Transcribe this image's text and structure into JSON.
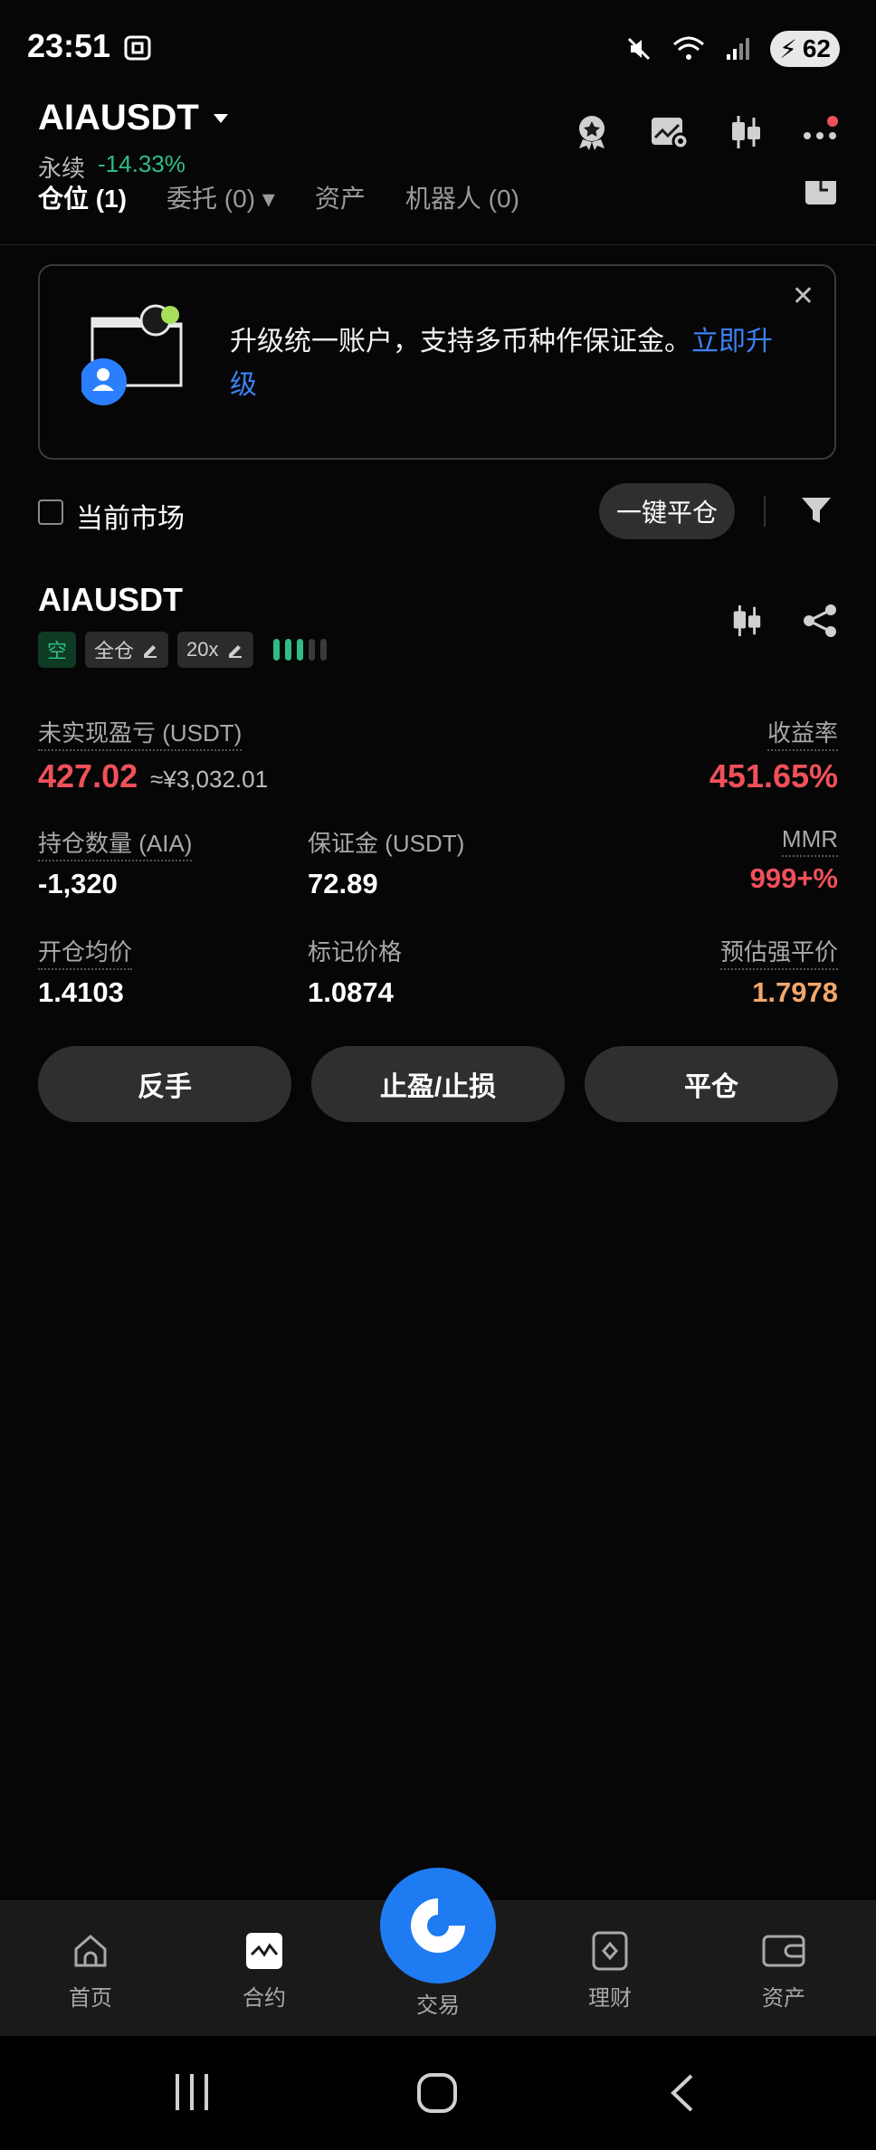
{
  "status_bar": {
    "time": "23:51",
    "battery": "62"
  },
  "header": {
    "symbol": "AIAUSDT",
    "market_type": "永续",
    "change": "-14.33%",
    "icons": [
      "badge-icon",
      "chart-settings-icon",
      "candlestick-icon",
      "more-icon"
    ]
  },
  "tabs": [
    {
      "label": "仓位 (1)"
    },
    {
      "label": "委托 (0)"
    },
    {
      "label": "资产"
    },
    {
      "label": "机器人 (0)"
    }
  ],
  "banner": {
    "text": "升级统一账户，支持多币种作保证金。",
    "link": "立即升级"
  },
  "filter": {
    "current_market_label": "当前市场",
    "close_all_label": "一键平仓"
  },
  "position": {
    "symbol": "AIAUSDT",
    "side_tag": "空",
    "margin_mode": "全仓",
    "leverage": "20x",
    "risk_level": 3,
    "risk_colors": [
      "#2fbd85",
      "#2fbd85",
      "#2fbd85",
      "#3a3a3a",
      "#3a3a3a"
    ],
    "unrealized_pnl_label": "未实现盈亏 (USDT)",
    "unrealized_pnl": "427.02",
    "unrealized_pnl_cny": "≈¥3,032.01",
    "roe_label": "收益率",
    "roe": "451.65%",
    "size_label": "持仓数量 (AIA)",
    "size": "-1,320",
    "margin_label": "保证金 (USDT)",
    "margin": "72.89",
    "mmr_label": "MMR",
    "mmr": "999+%",
    "entry_label": "开仓均价",
    "entry": "1.4103",
    "mark_label": "标记价格",
    "mark": "1.0874",
    "liq_label": "预估强平价",
    "liq": "1.7978"
  },
  "actions": {
    "reverse": "反手",
    "tpsl": "止盈/止损",
    "close": "平仓"
  },
  "bottom_nav": [
    {
      "label": "首页",
      "icon": "home-icon"
    },
    {
      "label": "合约",
      "icon": "futures-icon"
    },
    {
      "label": "交易",
      "icon": "trade-icon"
    },
    {
      "label": "理财",
      "icon": "earn-icon"
    },
    {
      "label": "资产",
      "icon": "wallet-icon"
    }
  ],
  "colors": {
    "accent": "#1e7bf2",
    "up": "#2fbd85",
    "down": "#f0505a",
    "warn": "#f3a76c"
  }
}
